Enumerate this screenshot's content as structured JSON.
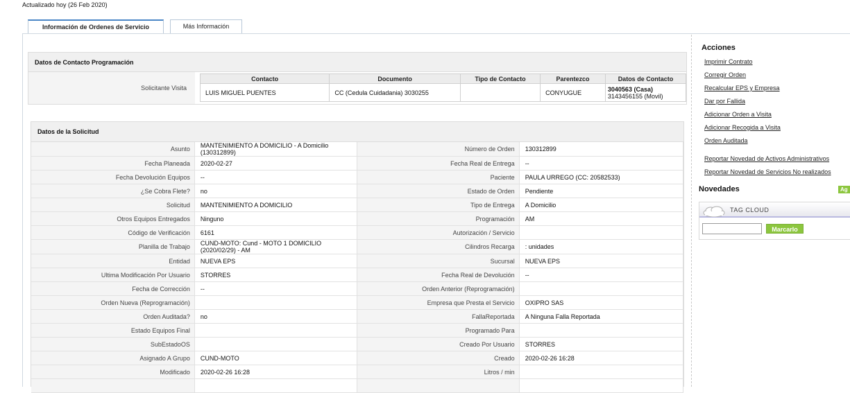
{
  "updated_text": "Actualizado hoy (26 Feb 2020)",
  "tabs": [
    {
      "label": "Información de Ordenes de Servicio",
      "active": true
    },
    {
      "label": "Más Información",
      "active": false
    }
  ],
  "contact_section": {
    "title": "Datos de Contacto Programación",
    "row_label": "Solicitante Visita",
    "columns": [
      "Contacto",
      "Documento",
      "Tipo de Contacto",
      "Parentezco",
      "Datos de Contacto"
    ],
    "row": {
      "contacto": "LUIS MIGUEL PUENTES",
      "documento": "CC (Cedula Cuidadania) 3030255",
      "tipo": "",
      "parentezco": "CONYUGUE",
      "datos_line1": "3040563 (Casa)",
      "datos_line2": "3143456155 (Movil)"
    }
  },
  "solicitud": {
    "title": "Datos de la Solicitud",
    "rows": [
      {
        "l1": "Asunto",
        "v1": "MANTENIMIENTO A DOMICILIO - A Domicilio (130312899)",
        "l2": "Número de Orden",
        "v2": "130312899"
      },
      {
        "l1": "Fecha Planeada",
        "v1": "2020-02-27",
        "l2": "Fecha Real de Entrega",
        "v2": "--"
      },
      {
        "l1": "Fecha Devolución Equipos",
        "v1": "--",
        "l2": "Paciente",
        "v2": "PAULA URREGO (CC: 20582533)"
      },
      {
        "l1": "¿Se Cobra Flete?",
        "v1": "no",
        "l2": "Estado de Orden",
        "v2": "Pendiente"
      },
      {
        "l1": "Solicitud",
        "v1": "MANTENIMIENTO A DOMICILIO",
        "l2": "Tipo de Entrega",
        "v2": "A Domicilio"
      },
      {
        "l1": "Otros Equipos Entregados",
        "v1": "Ninguno",
        "l2": "Programación",
        "v2": "AM"
      },
      {
        "l1": "Código de Verificación",
        "v1": "6161",
        "l2": "Autorización / Servicio",
        "v2": ""
      },
      {
        "l1": "Planilla de Trabajo",
        "v1": "CUND-MOTO: Cund - MOTO 1 DOMICILIO (2020/02/29) - AM",
        "l2": "Cilindros Recarga",
        "v2": ": unidades"
      },
      {
        "l1": "Entidad",
        "v1": "NUEVA EPS",
        "l2": "Sucursal",
        "v2": "NUEVA EPS"
      },
      {
        "l1": "Ultima Modificación Por Usuario",
        "v1": "STORRES",
        "l2": "Fecha Real de Devolución",
        "v2": "--"
      },
      {
        "l1": "Fecha de Corrección",
        "v1": "--",
        "l2": "Orden Anterior (Reprogramación)",
        "v2": ""
      },
      {
        "l1": "Orden Nueva (Reprogramación)",
        "v1": "",
        "l2": "Empresa que Presta el Servicio",
        "v2": "OXIPRO SAS"
      },
      {
        "l1": "Orden Auditada?",
        "v1": "no",
        "l2": "FallaReportada",
        "v2": "A Ninguna Falla Reportada"
      },
      {
        "l1": "Estado Equipos Final",
        "v1": "",
        "l2": "Programado Para",
        "v2": ""
      },
      {
        "l1": "SubEstadoOS",
        "v1": "",
        "l2": "Creado Por Usuario",
        "v2": "STORRES"
      },
      {
        "l1": "Asignado A Grupo",
        "v1": "CUND-MOTO",
        "l2": "Creado",
        "v2": "2020-02-26 16:28"
      },
      {
        "l1": "Modificado",
        "v1": "2020-02-26 16:28",
        "l2": "Litros / min",
        "v2": ""
      },
      {
        "l1": "",
        "v1": "",
        "l2": "",
        "v2": ""
      }
    ]
  },
  "acciones": {
    "title": "Acciones",
    "items": [
      "Imprimir Contrato",
      "Corregir Orden",
      "Recalcular EPS y Empresa",
      "Dar por Fallida",
      "Adicionar Orden a Visita",
      "Adicionar Recogida a Visita",
      "Orden Auditada",
      "",
      "Reportar Novedad de Activos Administrativos",
      "Reportar Novedad de Servicios No realizados"
    ]
  },
  "novedades": {
    "title": "Novedades",
    "badge": "Ag",
    "tag_cloud_label": "TAG CLOUD",
    "input_value": "",
    "button_label": "Marcarlo"
  },
  "colors": {
    "accent_green": "#8cc63e",
    "tab_blue": "#4a86c6"
  }
}
